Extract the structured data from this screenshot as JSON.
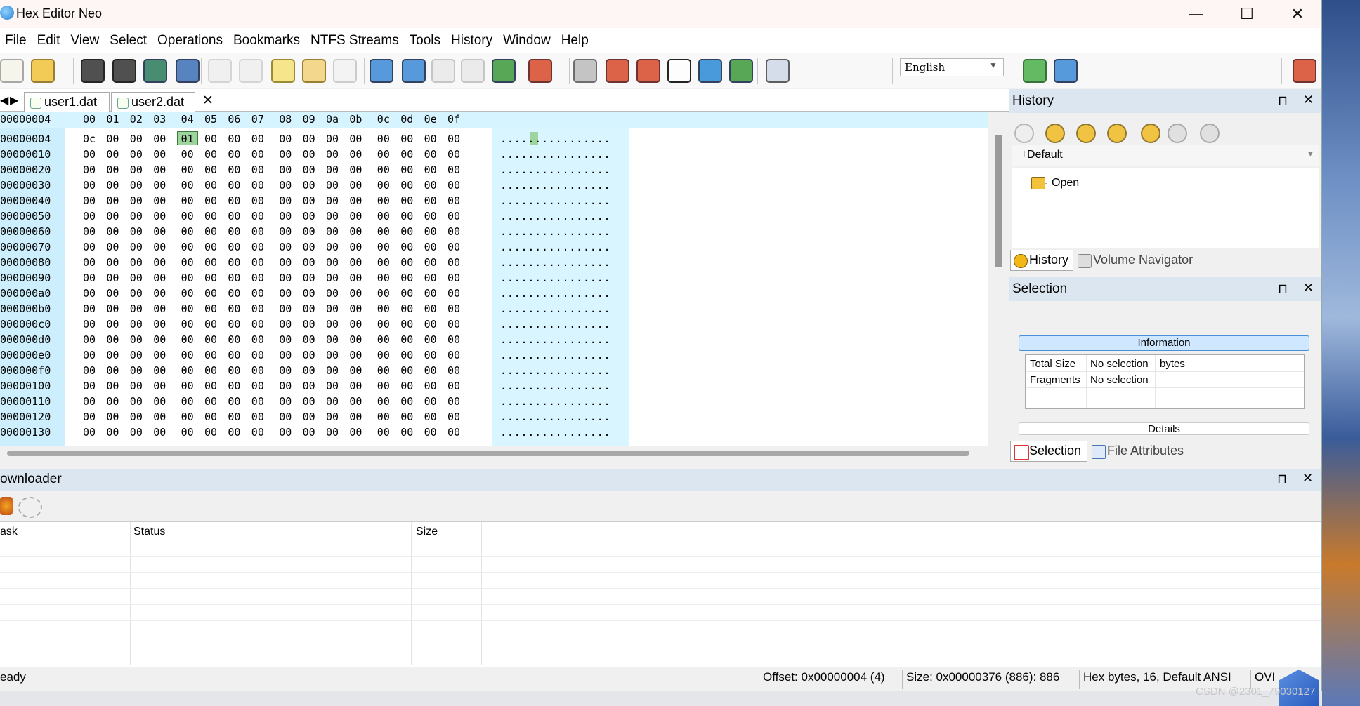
{
  "window": {
    "title": "Hex Editor Neo",
    "minimize": "—",
    "maximize": "☐",
    "close": "✕"
  },
  "menu": [
    "File",
    "Edit",
    "View",
    "Select",
    "Operations",
    "Bookmarks",
    "NTFS Streams",
    "Tools",
    "History",
    "Window",
    "Help"
  ],
  "toolbar": {
    "language": "English"
  },
  "tabs": [
    {
      "label": "user1.dat"
    },
    {
      "label": "user2.dat",
      "close": "✕"
    }
  ],
  "hex": {
    "header_offset": "00000004",
    "columns": [
      "00",
      "01",
      "02",
      "03",
      "04",
      "05",
      "06",
      "07",
      "08",
      "09",
      "0a",
      "0b",
      "0c",
      "0d",
      "0e",
      "0f"
    ],
    "rows": [
      {
        "offset": "00000004",
        "bytes": [
          "0c",
          "00",
          "00",
          "00",
          "01",
          "00",
          "00",
          "00",
          "00",
          "00",
          "00",
          "00",
          "00",
          "00",
          "00",
          "00"
        ],
        "ascii": "................"
      },
      {
        "offset": "00000010",
        "bytes": [
          "00",
          "00",
          "00",
          "00",
          "00",
          "00",
          "00",
          "00",
          "00",
          "00",
          "00",
          "00",
          "00",
          "00",
          "00",
          "00"
        ],
        "ascii": "................"
      },
      {
        "offset": "00000020",
        "bytes": [
          "00",
          "00",
          "00",
          "00",
          "00",
          "00",
          "00",
          "00",
          "00",
          "00",
          "00",
          "00",
          "00",
          "00",
          "00",
          "00"
        ],
        "ascii": "................"
      },
      {
        "offset": "00000030",
        "bytes": [
          "00",
          "00",
          "00",
          "00",
          "00",
          "00",
          "00",
          "00",
          "00",
          "00",
          "00",
          "00",
          "00",
          "00",
          "00",
          "00"
        ],
        "ascii": "................"
      },
      {
        "offset": "00000040",
        "bytes": [
          "00",
          "00",
          "00",
          "00",
          "00",
          "00",
          "00",
          "00",
          "00",
          "00",
          "00",
          "00",
          "00",
          "00",
          "00",
          "00"
        ],
        "ascii": "................"
      },
      {
        "offset": "00000050",
        "bytes": [
          "00",
          "00",
          "00",
          "00",
          "00",
          "00",
          "00",
          "00",
          "00",
          "00",
          "00",
          "00",
          "00",
          "00",
          "00",
          "00"
        ],
        "ascii": "................"
      },
      {
        "offset": "00000060",
        "bytes": [
          "00",
          "00",
          "00",
          "00",
          "00",
          "00",
          "00",
          "00",
          "00",
          "00",
          "00",
          "00",
          "00",
          "00",
          "00",
          "00"
        ],
        "ascii": "................"
      },
      {
        "offset": "00000070",
        "bytes": [
          "00",
          "00",
          "00",
          "00",
          "00",
          "00",
          "00",
          "00",
          "00",
          "00",
          "00",
          "00",
          "00",
          "00",
          "00",
          "00"
        ],
        "ascii": "................"
      },
      {
        "offset": "00000080",
        "bytes": [
          "00",
          "00",
          "00",
          "00",
          "00",
          "00",
          "00",
          "00",
          "00",
          "00",
          "00",
          "00",
          "00",
          "00",
          "00",
          "00"
        ],
        "ascii": "................"
      },
      {
        "offset": "00000090",
        "bytes": [
          "00",
          "00",
          "00",
          "00",
          "00",
          "00",
          "00",
          "00",
          "00",
          "00",
          "00",
          "00",
          "00",
          "00",
          "00",
          "00"
        ],
        "ascii": "................"
      },
      {
        "offset": "000000a0",
        "bytes": [
          "00",
          "00",
          "00",
          "00",
          "00",
          "00",
          "00",
          "00",
          "00",
          "00",
          "00",
          "00",
          "00",
          "00",
          "00",
          "00"
        ],
        "ascii": "................"
      },
      {
        "offset": "000000b0",
        "bytes": [
          "00",
          "00",
          "00",
          "00",
          "00",
          "00",
          "00",
          "00",
          "00",
          "00",
          "00",
          "00",
          "00",
          "00",
          "00",
          "00"
        ],
        "ascii": "................"
      },
      {
        "offset": "000000c0",
        "bytes": [
          "00",
          "00",
          "00",
          "00",
          "00",
          "00",
          "00",
          "00",
          "00",
          "00",
          "00",
          "00",
          "00",
          "00",
          "00",
          "00"
        ],
        "ascii": "................"
      },
      {
        "offset": "000000d0",
        "bytes": [
          "00",
          "00",
          "00",
          "00",
          "00",
          "00",
          "00",
          "00",
          "00",
          "00",
          "00",
          "00",
          "00",
          "00",
          "00",
          "00"
        ],
        "ascii": "................"
      },
      {
        "offset": "000000e0",
        "bytes": [
          "00",
          "00",
          "00",
          "00",
          "00",
          "00",
          "00",
          "00",
          "00",
          "00",
          "00",
          "00",
          "00",
          "00",
          "00",
          "00"
        ],
        "ascii": "................"
      },
      {
        "offset": "000000f0",
        "bytes": [
          "00",
          "00",
          "00",
          "00",
          "00",
          "00",
          "00",
          "00",
          "00",
          "00",
          "00",
          "00",
          "00",
          "00",
          "00",
          "00"
        ],
        "ascii": "................"
      },
      {
        "offset": "00000100",
        "bytes": [
          "00",
          "00",
          "00",
          "00",
          "00",
          "00",
          "00",
          "00",
          "00",
          "00",
          "00",
          "00",
          "00",
          "00",
          "00",
          "00"
        ],
        "ascii": "................"
      },
      {
        "offset": "00000110",
        "bytes": [
          "00",
          "00",
          "00",
          "00",
          "00",
          "00",
          "00",
          "00",
          "00",
          "00",
          "00",
          "00",
          "00",
          "00",
          "00",
          "00"
        ],
        "ascii": "................"
      },
      {
        "offset": "00000120",
        "bytes": [
          "00",
          "00",
          "00",
          "00",
          "00",
          "00",
          "00",
          "00",
          "00",
          "00",
          "00",
          "00",
          "00",
          "00",
          "00",
          "00"
        ],
        "ascii": "................"
      },
      {
        "offset": "00000130",
        "bytes": [
          "00",
          "00",
          "00",
          "00",
          "00",
          "00",
          "00",
          "00",
          "00",
          "00",
          "00",
          "00",
          "00",
          "00",
          "00",
          "00"
        ],
        "ascii": "................"
      }
    ],
    "selected_value": "01"
  },
  "history_panel": {
    "title": "History",
    "group": "Default",
    "entries": [
      "Open"
    ],
    "tabs": [
      "History",
      "Volume Navigator"
    ]
  },
  "selection_panel": {
    "title": "Selection",
    "information_label": "Information",
    "total_size_label": "Total Size",
    "total_size_value": "No selection",
    "total_size_unit": "bytes",
    "fragments_label": "Fragments",
    "fragments_value": "No selection",
    "details_label": "Details",
    "tabs": [
      "Selection",
      "File Attributes"
    ]
  },
  "downloader": {
    "title": "ownloader",
    "columns": [
      "ask",
      "Status",
      "Size"
    ]
  },
  "status": {
    "left": "eady",
    "offset": "Offset: 0x00000004 (4)",
    "size": "Size: 0x00000376 (886): 886",
    "mode": "Hex bytes, 16, Default ANSI",
    "ovr": "OVI"
  },
  "watermark": "CSDN @2301_79030127",
  "colors": {
    "accent": "#4a90d9",
    "panel_header": "#dbe6f0",
    "offset_bg": "#cdeffd",
    "selection": "#9ed49e"
  }
}
